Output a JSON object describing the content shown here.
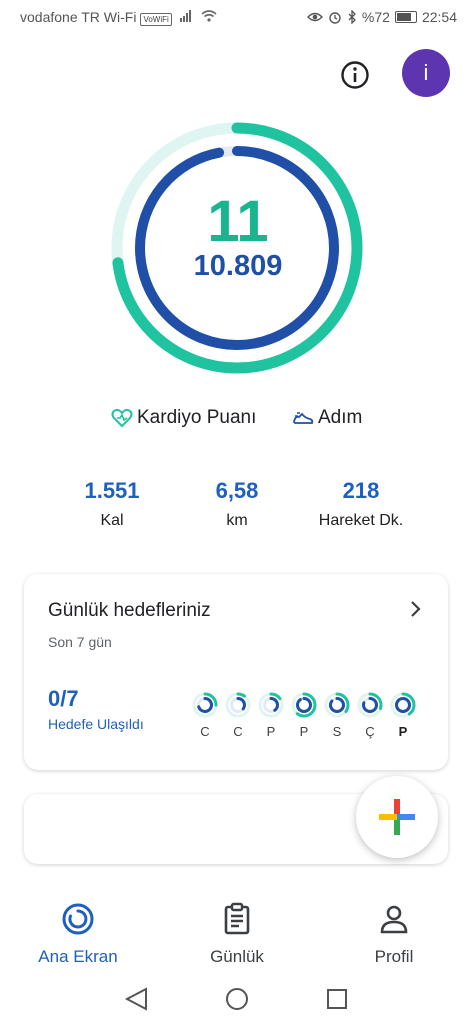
{
  "status_bar": {
    "carrier": "vodafone TR Wi-Fi",
    "volte_badge": "VoWiFi",
    "battery": "%72",
    "time": "22:54"
  },
  "header": {
    "info_icon": "info-icon",
    "avatar_letter": "i",
    "avatar_color": "#5e35b1"
  },
  "ring": {
    "cardio_points": "11",
    "steps": "10.809",
    "cardio_progress": 0.73,
    "steps_progress": 0.97,
    "cardio_color": "#1fc3a0",
    "steps_color": "#1f4fa6"
  },
  "legend": {
    "cardio_label": "Kardiyo Puanı",
    "steps_label": "Adım"
  },
  "stats": [
    {
      "value": "1.551",
      "label": "Kal"
    },
    {
      "value": "6,58",
      "label": "km"
    },
    {
      "value": "218",
      "label": "Hareket Dk."
    }
  ],
  "goals": {
    "title": "Günlük hedefleriniz",
    "subtitle": "Son 7 gün",
    "count": "0/7",
    "reached_label": "Hedefe Ulaşıldı",
    "days": [
      {
        "label": "C",
        "outer": 0.25,
        "inner": 0.7
      },
      {
        "label": "C",
        "outer": 0.1,
        "inner": 0.35
      },
      {
        "label": "P",
        "outer": 0.15,
        "inner": 0.4
      },
      {
        "label": "P",
        "outer": 0.6,
        "inner": 0.9
      },
      {
        "label": "S",
        "outer": 0.35,
        "inner": 0.85
      },
      {
        "label": "Ç",
        "outer": 0.3,
        "inner": 0.8
      },
      {
        "label": "P",
        "outer": 0.4,
        "inner": 0.95
      }
    ]
  },
  "bottom_nav": [
    {
      "label": "Ana Ekran",
      "icon": "home-ring-icon",
      "active": true
    },
    {
      "label": "Günlük",
      "icon": "clipboard-icon",
      "active": false
    },
    {
      "label": "Profil",
      "icon": "person-icon",
      "active": false
    }
  ]
}
